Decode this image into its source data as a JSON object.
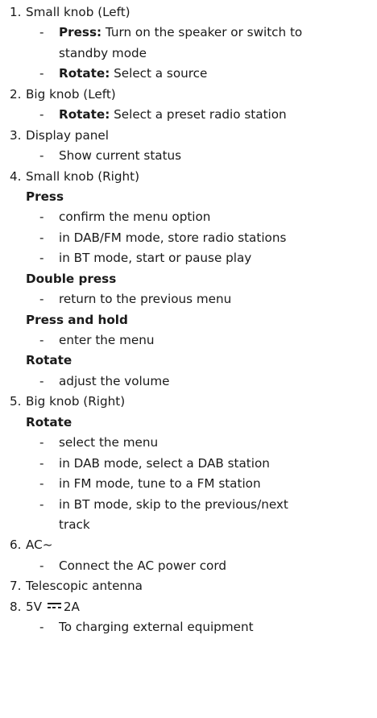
{
  "items": [
    {
      "number": "1.",
      "title": "Small knob (Left)",
      "press_label": "Press:",
      "press_text_1": "Turn on the speaker or switch to",
      "press_text_2": "standby mode",
      "rotate_label": "Rotate:",
      "rotate_text": "Select a source"
    },
    {
      "number": "2.",
      "title": "Big knob (Left)",
      "rotate_label": "Rotate:",
      "rotate_text": "Select a preset radio station"
    },
    {
      "number": "3.",
      "title": "Display panel",
      "detail": "Show current status"
    },
    {
      "number": "4.",
      "title": "Small knob (Right)",
      "press_heading": "Press",
      "press_1": "confirm the menu option",
      "press_2": "in DAB/FM mode, store radio stations",
      "press_3": "in BT mode, start or pause play",
      "double_heading": "Double press",
      "double_1": "return to the previous menu",
      "hold_heading": "Press and hold",
      "hold_1": "enter the menu",
      "rotate_heading": "Rotate",
      "rotate_1": "adjust the volume"
    },
    {
      "number": "5.",
      "title": "Big knob (Right)",
      "rotate_heading": "Rotate",
      "rotate_1": "select the menu",
      "rotate_2": "in DAB mode, select a DAB station",
      "rotate_3": "in FM mode, tune to a FM station",
      "rotate_4a": "in BT mode, skip to the previous/next",
      "rotate_4b": "track"
    },
    {
      "number": "6.",
      "title": "AC~",
      "detail": "Connect the AC power cord"
    },
    {
      "number": "7.",
      "title": "Telescopic antenna"
    },
    {
      "number": "8.",
      "title_prefix": "5V",
      "title_suffix": "2A",
      "dc_symbol": "dc-current-icon",
      "detail": "To charging external equipment"
    }
  ],
  "dash": "-"
}
